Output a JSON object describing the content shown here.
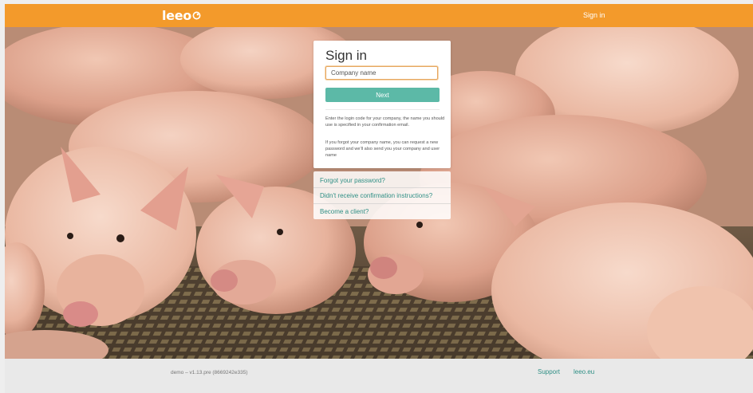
{
  "header": {
    "logo_text": "leeo",
    "signin_label": "Sign in",
    "bg_color": "#f39a2b"
  },
  "signin": {
    "title": "Sign in",
    "company_placeholder": "Company name",
    "next_label": "Next",
    "help_1": "Enter the login code for your company, the name you should use is specified in your confirmation email.",
    "help_2": "If you forgot your company name, you can request a new password and we'll also send you your company and user name"
  },
  "links": {
    "forgot_password": "Forgot your password?",
    "no_confirmation": "Didn't receive confirmation instructions?",
    "become_client": "Become a client?"
  },
  "footer": {
    "version": "demo – v1.13.pre (8669242e335)",
    "support": "Support",
    "site": "leeo.eu"
  },
  "colors": {
    "accent": "#f39a2b",
    "teal": "#5cb9a7",
    "link": "#2f8f85"
  },
  "icons": {
    "logo_mark": "leeo-circle-logo-icon"
  }
}
